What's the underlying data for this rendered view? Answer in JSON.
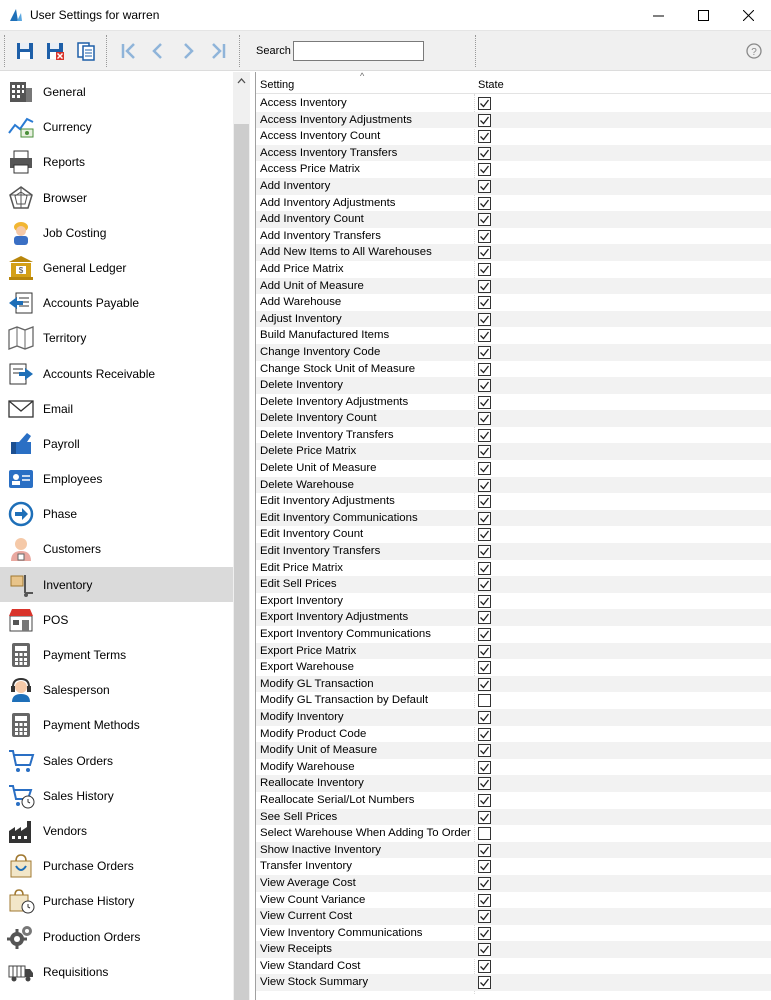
{
  "window": {
    "title": "User Settings for warren"
  },
  "toolbar": {
    "search_label": "Search",
    "search_value": ""
  },
  "sidebar": {
    "items": [
      {
        "label": "General",
        "icon": "building-icon"
      },
      {
        "label": "Currency",
        "icon": "currency-chart-icon"
      },
      {
        "label": "Reports",
        "icon": "printer-icon"
      },
      {
        "label": "Browser",
        "icon": "web-icon"
      },
      {
        "label": "Job Costing",
        "icon": "worker-icon"
      },
      {
        "label": "General Ledger",
        "icon": "bank-icon"
      },
      {
        "label": "Accounts Payable",
        "icon": "payable-icon"
      },
      {
        "label": "Territory",
        "icon": "map-icon"
      },
      {
        "label": "Accounts Receivable",
        "icon": "receivable-icon"
      },
      {
        "label": "Email",
        "icon": "envelope-icon"
      },
      {
        "label": "Payroll",
        "icon": "payroll-icon"
      },
      {
        "label": "Employees",
        "icon": "id-card-icon"
      },
      {
        "label": "Phase",
        "icon": "arrow-circle-icon"
      },
      {
        "label": "Customers",
        "icon": "customer-icon"
      },
      {
        "label": "Inventory",
        "icon": "inventory-icon"
      },
      {
        "label": "POS",
        "icon": "store-icon"
      },
      {
        "label": "Payment Terms",
        "icon": "calculator-icon"
      },
      {
        "label": "Salesperson",
        "icon": "headset-icon"
      },
      {
        "label": "Payment Methods",
        "icon": "calculator-icon"
      },
      {
        "label": "Sales Orders",
        "icon": "cart-icon"
      },
      {
        "label": "Sales History",
        "icon": "cart-history-icon"
      },
      {
        "label": "Vendors",
        "icon": "factory-icon"
      },
      {
        "label": "Purchase Orders",
        "icon": "bag-icon"
      },
      {
        "label": "Purchase History",
        "icon": "bag-history-icon"
      },
      {
        "label": "Production Orders",
        "icon": "gears-icon"
      },
      {
        "label": "Requisitions",
        "icon": "truck-icon"
      }
    ],
    "active_index": 14
  },
  "grid": {
    "col_setting": "Setting",
    "col_state": "State",
    "rows": [
      {
        "setting": "Access Inventory",
        "checked": true
      },
      {
        "setting": "Access Inventory Adjustments",
        "checked": true
      },
      {
        "setting": "Access Inventory Count",
        "checked": true
      },
      {
        "setting": "Access Inventory Transfers",
        "checked": true
      },
      {
        "setting": "Access Price Matrix",
        "checked": true
      },
      {
        "setting": "Add Inventory",
        "checked": true
      },
      {
        "setting": "Add Inventory Adjustments",
        "checked": true
      },
      {
        "setting": "Add Inventory Count",
        "checked": true
      },
      {
        "setting": "Add Inventory Transfers",
        "checked": true
      },
      {
        "setting": "Add New Items to All Warehouses",
        "checked": true
      },
      {
        "setting": "Add Price Matrix",
        "checked": true
      },
      {
        "setting": "Add Unit of Measure",
        "checked": true
      },
      {
        "setting": "Add Warehouse",
        "checked": true
      },
      {
        "setting": "Adjust Inventory",
        "checked": true
      },
      {
        "setting": "Build Manufactured Items",
        "checked": true
      },
      {
        "setting": "Change Inventory Code",
        "checked": true
      },
      {
        "setting": "Change Stock Unit of Measure",
        "checked": true
      },
      {
        "setting": "Delete Inventory",
        "checked": true
      },
      {
        "setting": "Delete Inventory Adjustments",
        "checked": true
      },
      {
        "setting": "Delete Inventory Count",
        "checked": true
      },
      {
        "setting": "Delete Inventory Transfers",
        "checked": true
      },
      {
        "setting": "Delete Price Matrix",
        "checked": true
      },
      {
        "setting": "Delete Unit of Measure",
        "checked": true
      },
      {
        "setting": "Delete Warehouse",
        "checked": true
      },
      {
        "setting": "Edit Inventory Adjustments",
        "checked": true
      },
      {
        "setting": "Edit Inventory Communications",
        "checked": true
      },
      {
        "setting": "Edit Inventory Count",
        "checked": true
      },
      {
        "setting": "Edit Inventory Transfers",
        "checked": true
      },
      {
        "setting": "Edit Price Matrix",
        "checked": true
      },
      {
        "setting": "Edit Sell Prices",
        "checked": true
      },
      {
        "setting": "Export Inventory",
        "checked": true
      },
      {
        "setting": "Export Inventory Adjustments",
        "checked": true
      },
      {
        "setting": "Export Inventory Communications",
        "checked": true
      },
      {
        "setting": "Export Price Matrix",
        "checked": true
      },
      {
        "setting": "Export Warehouse",
        "checked": true
      },
      {
        "setting": "Modify GL Transaction",
        "checked": true
      },
      {
        "setting": "Modify GL Transaction by Default",
        "checked": false
      },
      {
        "setting": "Modify Inventory",
        "checked": true
      },
      {
        "setting": "Modify Product Code",
        "checked": true
      },
      {
        "setting": "Modify Unit of Measure",
        "checked": true
      },
      {
        "setting": "Modify Warehouse",
        "checked": true
      },
      {
        "setting": "Reallocate Inventory",
        "checked": true
      },
      {
        "setting": "Reallocate Serial/Lot Numbers",
        "checked": true
      },
      {
        "setting": "See Sell Prices",
        "checked": true
      },
      {
        "setting": "Select Warehouse When Adding To Order",
        "checked": false
      },
      {
        "setting": "Show Inactive Inventory",
        "checked": true
      },
      {
        "setting": "Transfer Inventory",
        "checked": true
      },
      {
        "setting": "View Average Cost",
        "checked": true
      },
      {
        "setting": "View Count Variance",
        "checked": true
      },
      {
        "setting": "View Current Cost",
        "checked": true
      },
      {
        "setting": "View Inventory Communications",
        "checked": true
      },
      {
        "setting": "View Receipts",
        "checked": true
      },
      {
        "setting": "View Standard Cost",
        "checked": true
      },
      {
        "setting": "View Stock Summary",
        "checked": true
      }
    ]
  },
  "colors": {
    "accent": "#1e6fb8",
    "active_row": "#dadada",
    "alt_row": "#f2f2f2"
  }
}
